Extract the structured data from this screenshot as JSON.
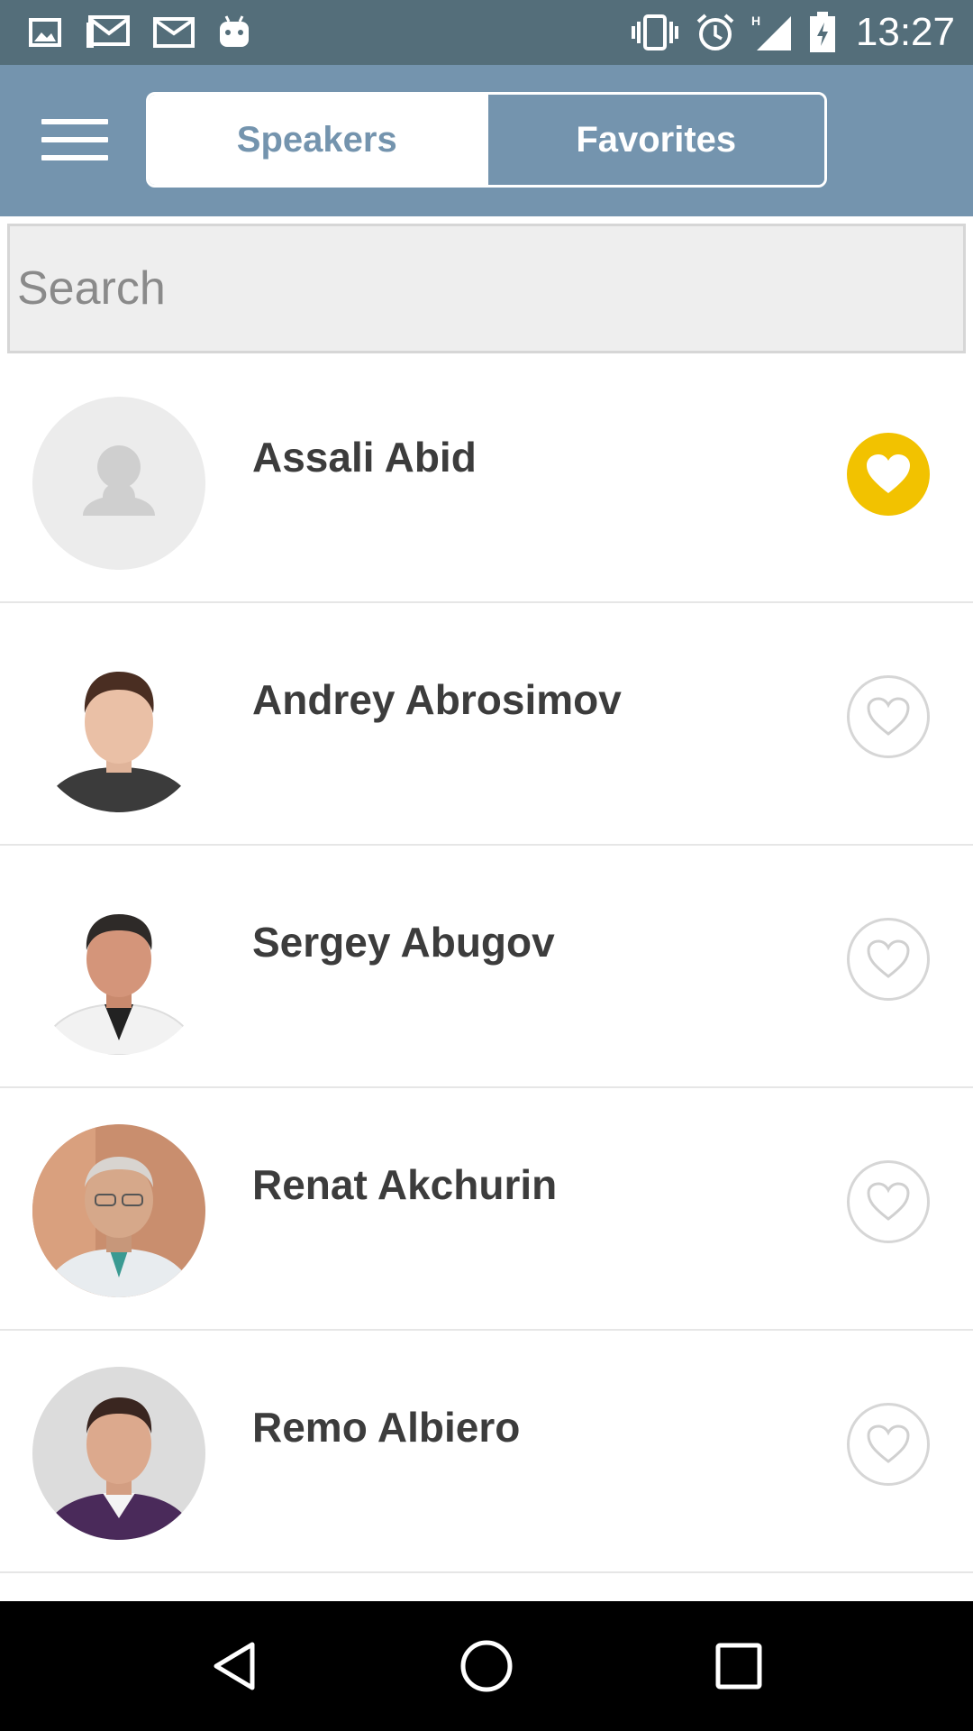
{
  "status_bar": {
    "time": "13:27",
    "network_type": "H",
    "left_icons": [
      "image-icon",
      "gmail-icon",
      "mail-icon",
      "android-icon"
    ],
    "right_icons": [
      "vibrate-icon",
      "alarm-icon",
      "signal-icon",
      "battery-charging-icon"
    ]
  },
  "header": {
    "menu_icon": "hamburger-menu-icon",
    "tabs": [
      {
        "label": "Speakers",
        "active": true
      },
      {
        "label": "Favorites",
        "active": false
      }
    ]
  },
  "search": {
    "placeholder": "Search",
    "value": ""
  },
  "speakers": [
    {
      "name": "Assali Abid",
      "avatar": "placeholder",
      "favorite": true
    },
    {
      "name": "Andrey Abrosimov",
      "avatar": "photo",
      "favorite": false
    },
    {
      "name": "Sergey Abugov",
      "avatar": "photo",
      "favorite": false
    },
    {
      "name": "Renat Akchurin",
      "avatar": "photo",
      "favorite": false
    },
    {
      "name": "Remo Albiero",
      "avatar": "photo",
      "favorite": false
    }
  ],
  "colors": {
    "header": "#7494ae",
    "status_bar": "#546e7a",
    "favorite_on": "#f2c200",
    "name_text": "#3c3c3c"
  },
  "nav_bar": {
    "buttons": [
      "back-icon",
      "home-icon",
      "recents-icon"
    ]
  }
}
